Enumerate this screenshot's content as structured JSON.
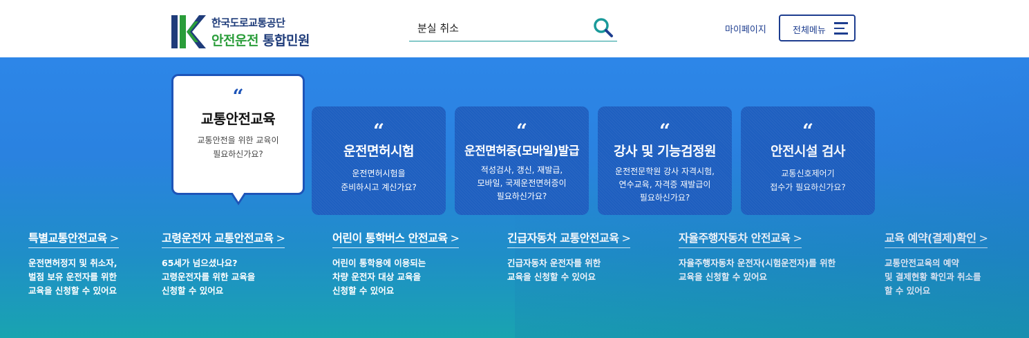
{
  "header": {
    "logo_top": "한국도로교통공단",
    "logo_bottom_a": "안전운전",
    "logo_bottom_b": "통합민원",
    "search_value": "분실 취소",
    "mypage": "마이페이지",
    "allmenu": "전체메뉴"
  },
  "colors": {
    "brand_navy": "#1d3d8f",
    "brand_green": "#2a9d3a",
    "search_teal": "#1a9a9a",
    "card_blue": "#1e5fc0"
  },
  "cards": [
    {
      "quote": "“",
      "title": "교통안전교육",
      "desc": "교통안전을 위한 교육이\n필요하신가요?",
      "active": true
    },
    {
      "quote": "“",
      "title": "운전면허시험",
      "desc": "운전면허시험을\n준비하시고 계신가요?"
    },
    {
      "quote": "“",
      "title": "운전면허증(모바일)발급",
      "desc": "적성검사, 갱신, 재발급,\n모바일, 국제운전면허증이\n필요하신가요?"
    },
    {
      "quote": "“",
      "title": "강사 및 기능검정원",
      "desc": "운전전문학원 강사 자격시험,\n연수교육, 자격증 재발급이\n필요하신가요?"
    },
    {
      "quote": "“",
      "title": "안전시설 검사",
      "desc": "교통신호제어기\n접수가 필요하신가요?"
    }
  ],
  "links": [
    {
      "title": "특별교통안전교육",
      "arrow": ">",
      "desc": "운전면허정지 및 취소자,\n벌점 보유 운전자를 위한\n교육을 신청할 수 있어요"
    },
    {
      "title": "고령운전자 교통안전교육",
      "arrow": ">",
      "desc": "65세가 넘으셨나요?\n고령운전자를 위한 교육을\n신청할 수 있어요"
    },
    {
      "title": "어린이 통학버스 안전교육",
      "arrow": ">",
      "desc": "어린이 통학용에 이용되는\n차량 운전자 대상 교육을\n신청할 수 있어요"
    },
    {
      "title": "긴급자동차 교통안전교육",
      "arrow": ">",
      "desc": "긴급자동차 운전자를 위한\n교육을 신청할 수 있어요"
    },
    {
      "title": "자율주행자동차 안전교육",
      "arrow": ">",
      "desc": "자율주행자동차 운전자(시험운전자)를 위한\n교육을 신청할 수 있어요"
    },
    {
      "title": "교육 예약(결제)확인",
      "arrow": ">",
      "desc": "교통안전교육의 예약\n및 결제현황 확인과 취소를\n할 수 있어요"
    }
  ]
}
